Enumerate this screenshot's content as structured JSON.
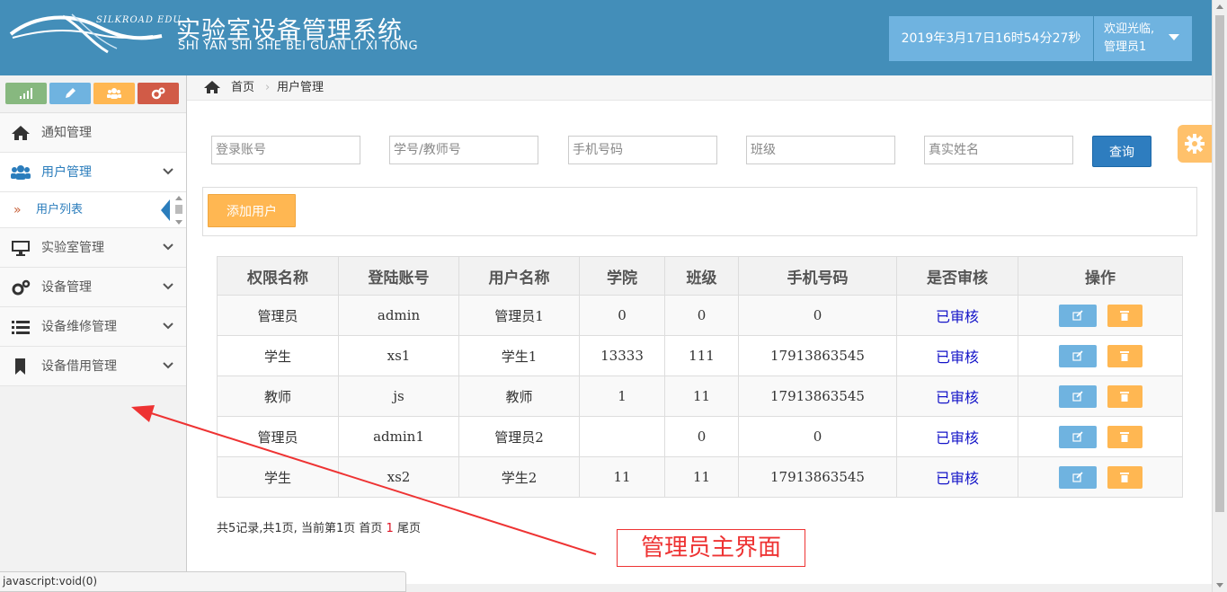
{
  "header": {
    "logo_text": "SILKROAD EDU",
    "title": "实验室设备管理系统",
    "subtitle": "SHI YAN SHI SHE BEI GUAN LI XI TONG",
    "datetime": "2019年3月17日16时54分27秒",
    "welcome": "欢迎光临,",
    "username": "管理员1"
  },
  "sidebar": {
    "shortcuts": [
      {
        "icon": "signal-icon",
        "color": "#87b87f"
      },
      {
        "icon": "pencil-icon",
        "color": "#6fb3e0"
      },
      {
        "icon": "users-icon",
        "color": "#ffb752"
      },
      {
        "icon": "cogs-icon",
        "color": "#d15b47"
      }
    ],
    "items": [
      {
        "label": "通知管理",
        "icon": "home-icon"
      },
      {
        "label": "用户管理",
        "icon": "users-icon",
        "active": true
      },
      {
        "label": "实验室管理",
        "icon": "desktop-icon"
      },
      {
        "label": "设备管理",
        "icon": "cogs-icon"
      },
      {
        "label": "设备维修管理",
        "icon": "list-icon"
      },
      {
        "label": "设备借用管理",
        "icon": "bookmark-icon"
      }
    ],
    "sub_items": [
      {
        "label": "用户列表"
      }
    ]
  },
  "breadcrumb": {
    "home": "首页",
    "current": "用户管理"
  },
  "search": {
    "account_placeholder": "登录账号",
    "id_placeholder": "学号/教师号",
    "phone_placeholder": "手机号码",
    "class_placeholder": "班级",
    "name_placeholder": "真实姓名",
    "query_label": "查询"
  },
  "add_user_label": "添加用户",
  "table": {
    "headers": [
      "权限名称",
      "登陆账号",
      "用户名称",
      "学院",
      "班级",
      "手机号码",
      "是否审核",
      "操作"
    ],
    "rows": [
      {
        "role": "管理员",
        "account": "admin",
        "name": "管理员1",
        "college": "0",
        "class": "0",
        "phone": "0",
        "status": "已审核"
      },
      {
        "role": "学生",
        "account": "xs1",
        "name": "学生1",
        "college": "13333",
        "class": "111",
        "phone": "17913863545",
        "status": "已审核"
      },
      {
        "role": "教师",
        "account": "js",
        "name": "教师",
        "college": "1",
        "class": "11",
        "phone": "17913863545",
        "status": "已审核"
      },
      {
        "role": "管理员",
        "account": "admin1",
        "name": "管理员2",
        "college": "",
        "class": "0",
        "phone": "0",
        "status": "已审核"
      },
      {
        "role": "学生",
        "account": "xs2",
        "name": "学生2",
        "college": "11",
        "class": "11",
        "phone": "17913863545",
        "status": "已审核"
      }
    ]
  },
  "pager": {
    "summary": "共5记录,共1页, 当前第1页",
    "first": "首页",
    "current": "1",
    "last": "尾页"
  },
  "annotation": "管理员主界面",
  "status_bar": "javascript:void(0)",
  "colors": {
    "header_bg": "#438eb9",
    "accent_blue": "#2e7dbf",
    "warning_orange": "#ffb752",
    "verified_blue": "#1414c8",
    "annotation_red": "#e33"
  }
}
